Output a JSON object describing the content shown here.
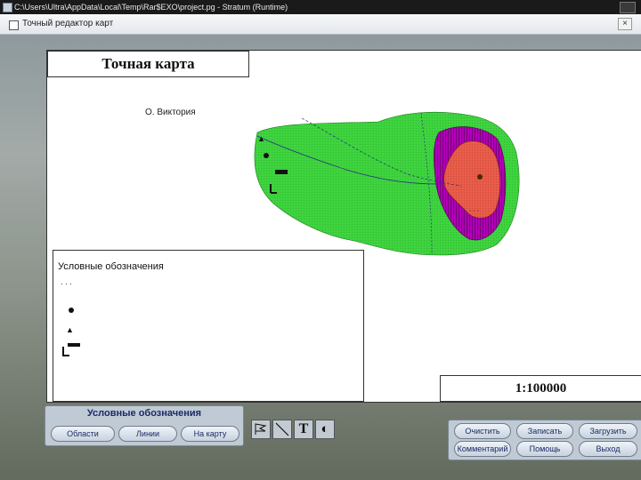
{
  "app": {
    "title": "C:\\Users\\Ultra\\AppData\\Local\\Temp\\Rar$EXO\\project.pg - Stratum (Runtime)"
  },
  "window": {
    "title": "Точный редактор карт",
    "close_glyph": "×"
  },
  "map": {
    "title": "Точная карта",
    "island_label": "О. Виктория",
    "scale": "1:100000",
    "zone_colors": {
      "outer": "#3fd43f",
      "middle": "#b100b6",
      "inner": "#e85c4a",
      "contour": "#2a2a8a"
    },
    "legend": {
      "title": "Условные обозначения"
    }
  },
  "legend_toolbar": {
    "title": "Условные обозначения",
    "buttons": [
      "Области",
      "Линии",
      "На карту"
    ]
  },
  "tools": [
    {
      "name": "flag-tool-icon"
    },
    {
      "name": "line-tool-icon"
    },
    {
      "name": "text-tool-icon",
      "glyph": "T"
    },
    {
      "name": "fill-tool-icon",
      "glyph": "◐"
    }
  ],
  "right_toolbar": {
    "buttons": [
      "Очистить",
      "Записать",
      "Загрузить",
      "Комментарий",
      "Помощь",
      "Выход"
    ]
  }
}
